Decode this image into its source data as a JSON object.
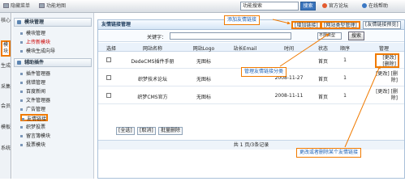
{
  "topbar": {
    "items": [
      "隐藏菜单",
      "功能地图"
    ],
    "search_value": "功能搜索",
    "search_button": "搜索",
    "links": [
      "官方论坛",
      "在线帮助"
    ]
  },
  "left_tabs": [
    "核心",
    "模块",
    "生成",
    "采集",
    "会员",
    "模板",
    "系统"
  ],
  "sidebar": {
    "sections": [
      {
        "title": "模块管理",
        "items": [
          "模块管理",
          "上传新模块",
          "模块生成向导"
        ]
      },
      {
        "title": "辅助插件",
        "items": [
          "插件管理器",
          "挑错管理",
          "百度新闻",
          "文件管理器",
          "广告管理",
          "友情链接",
          "织梦投票",
          "留言簿模块",
          "投票模块"
        ]
      }
    ],
    "active_item": "友情链接",
    "red_item": "上传新模块"
  },
  "panel": {
    "title": "友情链接管理",
    "header_buttons": [
      "[增加链接]",
      "[网站类型管理]",
      "[友情链接预览]"
    ],
    "search_label": "关键字：",
    "search_select": "不限类型",
    "search_button": "搜索"
  },
  "table": {
    "columns": [
      "选择",
      "网站名称",
      "网站Logo",
      "站长Email",
      "时间",
      "状态",
      "顺序",
      "管理"
    ],
    "rows": [
      {
        "name": "DedeCMS插件手册",
        "logo": "无图标",
        "email": "",
        "time": "",
        "status": "首页",
        "order": "1",
        "actions": "[更改] [删除]"
      },
      {
        "name": "织梦技术论坛",
        "logo": "无图标",
        "email": "",
        "time": "2008-11-27",
        "status": "首页",
        "order": "1",
        "actions": "[更改] [删除]"
      },
      {
        "name": "织梦CMS官方",
        "logo": "无图标",
        "email": "",
        "time": "2008-11-11",
        "status": "首页",
        "order": "1",
        "actions": "[更改] [删除]"
      }
    ],
    "footer_buttons": [
      "[全选]",
      "[取消]",
      "批量删除"
    ],
    "pager": "共 1 页/3条记录"
  },
  "annotations": {
    "add_link": "添加友情链接",
    "manage_type": "管理友情链接分类",
    "edit_delete": "更改或者删除某个友情链接"
  },
  "colors": {
    "highlight": "#f07a00",
    "accent": "#3a74bc"
  }
}
